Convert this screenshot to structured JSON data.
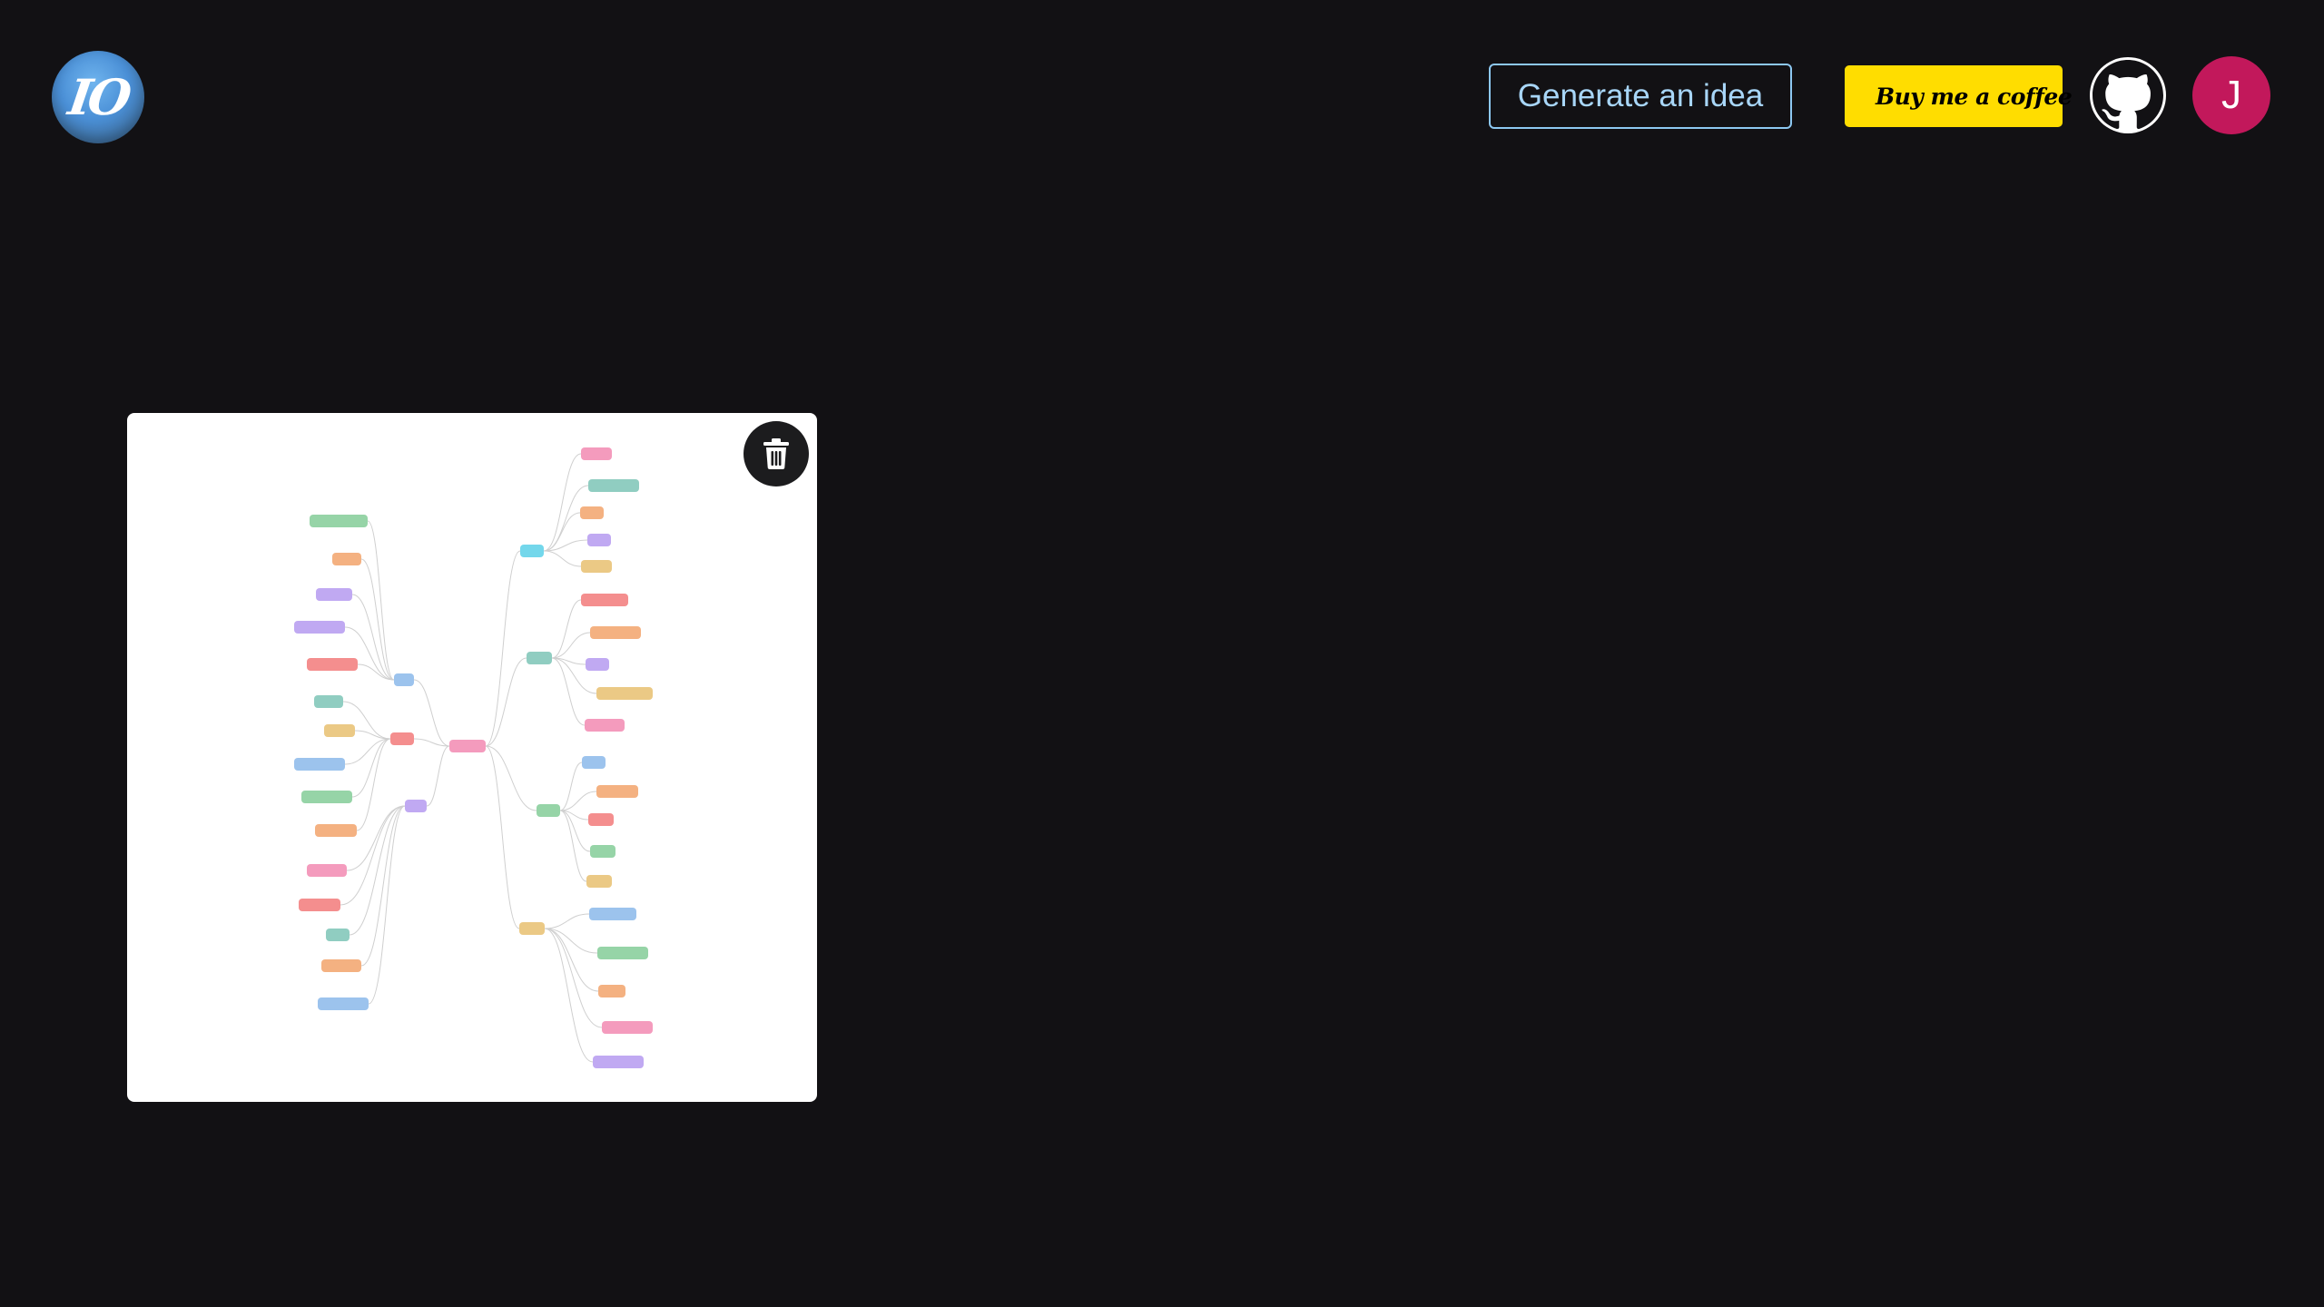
{
  "header": {
    "logo_text": "IO",
    "generate_label": "Generate an idea",
    "coffee_label": "Buy me a coffee",
    "avatar_initial": "J"
  },
  "icons": {
    "github": "github-icon",
    "delete": "trash-icon",
    "coffee": "coffee-cup-icon"
  },
  "colors": {
    "background": "#121114",
    "accent_border": "#8dc8f2",
    "coffee_yellow": "#ffdd00",
    "avatar_bg": "#c2185b",
    "card_bg": "#ffffff"
  },
  "cards": [
    {
      "kind": "mind-map-thumbnail",
      "node_colors": [
        "#f28ab2",
        "#7dc4b6",
        "#f2a36b",
        "#b59af0",
        "#f29b72",
        "#8bb8ea",
        "#e8c070",
        "#84cc98",
        "#5ad0e8",
        "#f27a7a"
      ]
    }
  ]
}
